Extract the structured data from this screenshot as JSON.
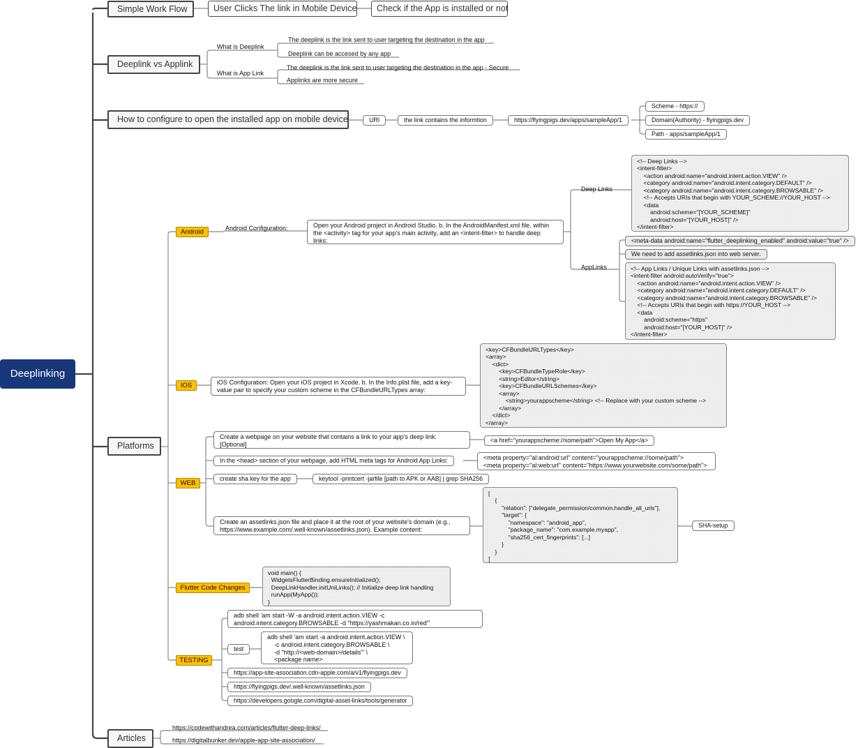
{
  "root": {
    "label": "Deeplinking"
  },
  "workflow": {
    "label": "Simple Work Flow",
    "steps": [
      "User Clicks The link in Mobile Device",
      "Check if the App is installed or not"
    ]
  },
  "deeplink_vs_applink": {
    "label": "Deeplink vs Applink",
    "deeplink": {
      "label": "What is Deeplink",
      "items": [
        "The deeplink is the link sent to user targeting the destination in the app",
        "Deeplink can be accesed by any app"
      ]
    },
    "applink": {
      "label": "What is App Link",
      "items": [
        "The deeplink is the link sent to user targeting the destination in the app - Secure",
        "Applinks are more secure"
      ]
    }
  },
  "configure": {
    "label": "How to configure to open the installed app on mobile device",
    "uri": "URI",
    "uri_desc": "the link contains the informtion",
    "example_url": "https://flyingpigs.dev/apps/sampleApp/1",
    "parts": [
      "Scheme - https://",
      "Domain(Authority) - flyingpigs.dev",
      "Path - apps/sampleApp/1"
    ]
  },
  "platforms": {
    "label": "Platforms",
    "android": {
      "tag": "Android",
      "config_label": "Android Configuration:",
      "config_text": "Open your Android project in Android Studio. b. In the AndroidManifest.xml file, within\nthe <activity> tag for your app's main activity, add an <intent-filter> to handle deep\nlinks:",
      "deep_links_label": "Deep Links",
      "deep_links_code": "<!-- Deep Links -->\n<intent-filter>\n    <action android:name=\"android.intent.action.VIEW\" />\n    <category android:name=\"android.intent.category.DEFAULT\" />\n    <category android:name=\"android.intent.category.BROWSABLE\" />\n    <!-- Accepts URIs that begin with YOUR_SCHEME://YOUR_HOST -->\n    <data\n        android:scheme=\"[YOUR_SCHEME]\"\n        android:host=\"[YOUR_HOST]\" />\n</intent-filter>",
      "applinks_label": "AppLinks",
      "applinks_meta": "<meta-data android:name=\"flutter_deeplinking_enabled\" android:value=\"true\" />",
      "applinks_note": "We need to add assetlinks.json into web server.",
      "applinks_code": "<!-- App Links / Unique Links with assetlinks.json -->\n<intent-filter android:autoVerify=\"true\">\n    <action android:name=\"android.intent.action.VIEW\" />\n    <category android:name=\"android.intent.category.DEFAULT\" />\n    <category android:name=\"android.intent.category.BROWSABLE\" />\n    <!-- Accepts URIs that begin with https://YOUR_HOST -->\n    <data\n        android:scheme=\"https\"\n        android:host=\"[YOUR_HOST]\" />\n</intent-filter>"
    },
    "ios": {
      "tag": "IOS",
      "config_text": "iOS Configuration: Open your iOS project in Xcode. b. In the Info.plist file, add a key-\nvalue pair to specify your custom scheme in the CFBundleURLTypes array:",
      "code": "<key>CFBundleURLTypes</key>\n<array>\n    <dict>\n        <key>CFBundleTypeRole</key>\n        <string>Editor</string>\n        <key>CFBundleURLSchemes</key>\n        <array>\n            <string>yourappscheme</string> <!-- Replace with your custom scheme -->\n        </array>\n    </dict>\n</array>"
    },
    "web": {
      "tag": "WEB",
      "webpage_text": "Create a webpage on your website that contains a link to your app's deep link:\n[Optional]",
      "webpage_code": "<a href=\"yourappscheme://some/path\">Open My App</a>",
      "meta_text": "In the <head> section of your webpage, add HTML meta tags for Android App Links:",
      "meta_code": "<meta property=\"al:android:url\" content=\"yourappscheme://some/path\">\n<meta property=\"al:web:url\" content=\"https://www.yourwebsite.com/some/path\">",
      "sha_text": "create sha key for the app",
      "sha_code": "keytool -printcert -jarfile [path to APK or AAB] | grep SHA256",
      "assetlinks_text": "Create an assetlinks.json file and place it at the root of your website's domain (e.g.,\nhttps://www.example.com/.well-known/assetlinks.json). Example content:",
      "assetlinks_code": "[\n    {\n        \"relation\": [\"delegate_permission/common.handle_all_urls\"],\n        \"target\": {\n            \"namespace\": \"android_app\",\n            \"package_name\": \"com.example.myapp\",\n            \"sha256_cert_fingerprints\": [...]\n        }\n    }\n]",
      "sha_setup": "SHA-setup"
    },
    "flutter": {
      "tag": "Flutter Code Changes",
      "code": "void main() {\n  WidgetsFlutterBinding.ensureInitialized();\n  DeepLinkHandler.initUniLinks(); // Initialize deep link handling\n  runApp(MyApp());\n}"
    },
    "testing": {
      "tag": "TESTING",
      "adb_command": "adb shell 'am start -W -a android.intent.action.VIEW -c\nandroid.intent.category.BROWSABLE -d \"https://yashmakan.co.in/red\"'",
      "test_label": "test",
      "test_command": "adb shell 'am start -a android.intent.action.VIEW \\\n    -c android.intent.category.BROWSABLE \\\n    -d \"http://<web-domain>/details\"' \\\n    <package name>",
      "links": [
        "https://app-site-association.cdn-apple.com/a/v1/flyingpigs.dev",
        "https://flyingpigs.dev/.well-known/assetlinks.json",
        "https://developers.google.com/digital-asset-links/tools/generator"
      ]
    }
  },
  "articles": {
    "label": "Articles",
    "links": [
      "https://codewithandrea.com/articles/flutter-deep-links/",
      "https://digitalbunker.dev/apple-app-site-association/"
    ]
  },
  "colors": {
    "root_bg": "#17377a",
    "tag_bg": "#ffbf00",
    "line_dark": "#444444",
    "line_light": "#888888"
  }
}
